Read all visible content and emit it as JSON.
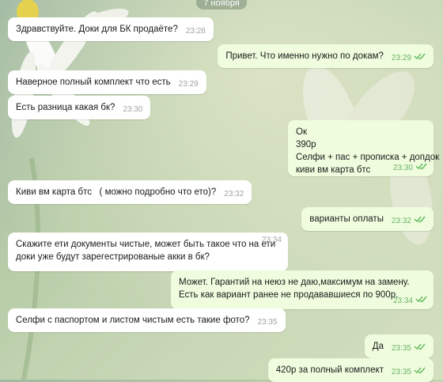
{
  "date_label": "7 ноября",
  "colors": {
    "incoming_bubble": "#ffffff",
    "outgoing_bubble": "#effdde",
    "outgoing_time": "#6cb367",
    "incoming_time": "#a3a3a3",
    "read_check": "#5fb85a"
  },
  "messages": [
    {
      "dir": "in",
      "text": "Здравствуйте. Доки для БК продаёте?",
      "time": "23:28"
    },
    {
      "dir": "out",
      "text": "Привет. Что именно нужно по докам?",
      "time": "23:29",
      "read": true
    },
    {
      "dir": "in",
      "text": "Наверное полный комплект что есть",
      "time": "23:29"
    },
    {
      "dir": "in",
      "text": "Есть разница какая бк?",
      "time": "23:30"
    },
    {
      "dir": "out",
      "lines": [
        "Ок",
        "390р",
        "Селфи + пас + прописка + допдок",
        "киви вм карта бтс"
      ],
      "time": "23:30",
      "read": true
    },
    {
      "dir": "in",
      "text": "Киви вм карта бтс   ( можно подробно что ето)?",
      "time": "23:32"
    },
    {
      "dir": "out",
      "text": "варианты оплаты",
      "time": "23:32",
      "read": true
    },
    {
      "dir": "in",
      "lines": [
        "Скажите ети документы чистые, может быть такое что на ети",
        "доки уже будут зарегестрированые акки в бк?"
      ],
      "time": "23:34"
    },
    {
      "dir": "out",
      "lines": [
        "Может. Гарантий на неюз не даю,максимум на замену.",
        "Есть как вариант ранее не продававшиеся по 900р."
      ],
      "time": "23:34",
      "read": true
    },
    {
      "dir": "in",
      "text": "Селфи с паспортом и листом чистым есть такие фото?",
      "time": "23:35"
    },
    {
      "dir": "out",
      "text": "Да",
      "time": "23:35",
      "read": true
    },
    {
      "dir": "out",
      "text": "420р за полный комплект",
      "time": "23:35",
      "read": true
    }
  ]
}
